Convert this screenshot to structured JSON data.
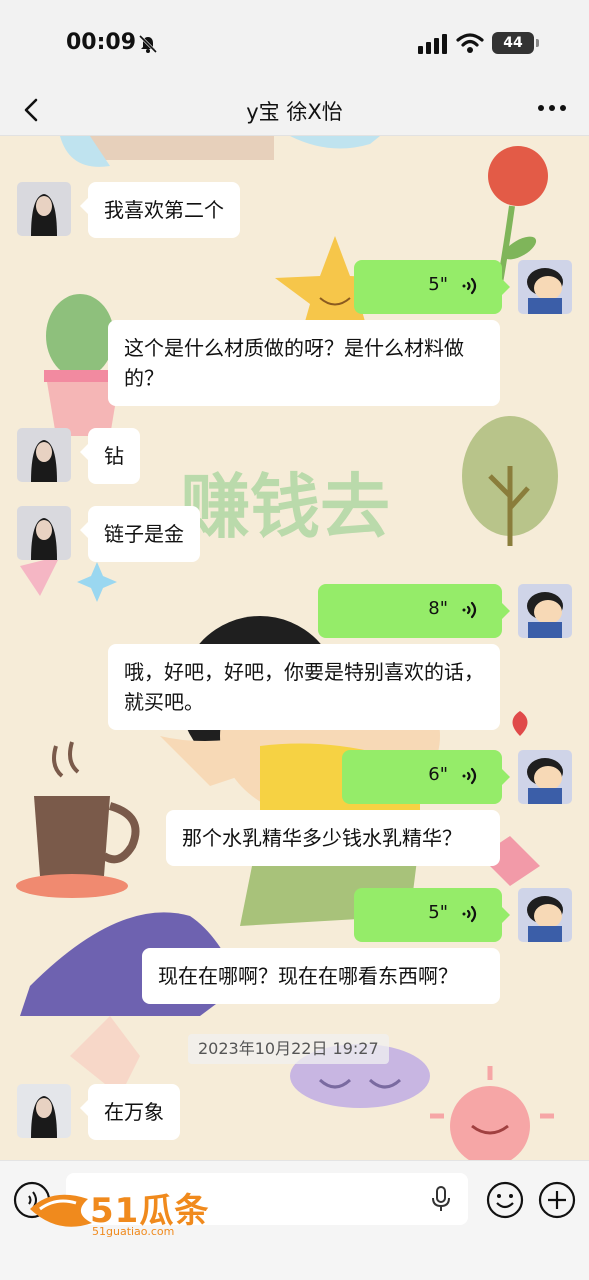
{
  "status_bar": {
    "time": "00:09",
    "battery": "44",
    "icons": [
      "mute-icon",
      "signal-icon",
      "wifi-icon",
      "battery-icon"
    ]
  },
  "header": {
    "title": "y宝 徐X怡",
    "icons": [
      "back-icon",
      "more-icon"
    ]
  },
  "chat": {
    "background_text": "赚钱去",
    "messages": [
      {
        "side": "left",
        "type": "text",
        "text": "我喜欢第二个"
      },
      {
        "side": "right",
        "type": "voice",
        "duration": "5\"",
        "transcript": "这个是什么材质做的呀？是什么材料做的？"
      },
      {
        "side": "left",
        "type": "text",
        "text": "钻"
      },
      {
        "side": "left",
        "type": "text",
        "text": "链子是金"
      },
      {
        "side": "right",
        "type": "voice",
        "duration": "8\"",
        "transcript": "哦，好吧，好吧，你要是特别喜欢的话，就买吧。"
      },
      {
        "side": "right",
        "type": "voice",
        "duration": "6\"",
        "transcript": "那个水乳精华多少钱水乳精华？"
      },
      {
        "side": "right",
        "type": "voice",
        "duration": "5\"",
        "transcript": "现在在哪啊？现在在哪看东西啊？"
      },
      {
        "side": "left",
        "type": "text",
        "text": "在万象"
      }
    ],
    "timestamp": "2023年10月22日 19:27"
  },
  "input_bar": {
    "watermark_text": "51瓜条",
    "watermark_sub": "51guatiao.com",
    "icons": [
      "voice-input-icon",
      "mic-icon",
      "emoji-icon",
      "plus-icon"
    ]
  },
  "colors": {
    "voice_bubble": "#95ec69",
    "text_bubble": "#ffffff",
    "chat_background": "#f6ecd8",
    "watermark": "#f08a1d"
  }
}
